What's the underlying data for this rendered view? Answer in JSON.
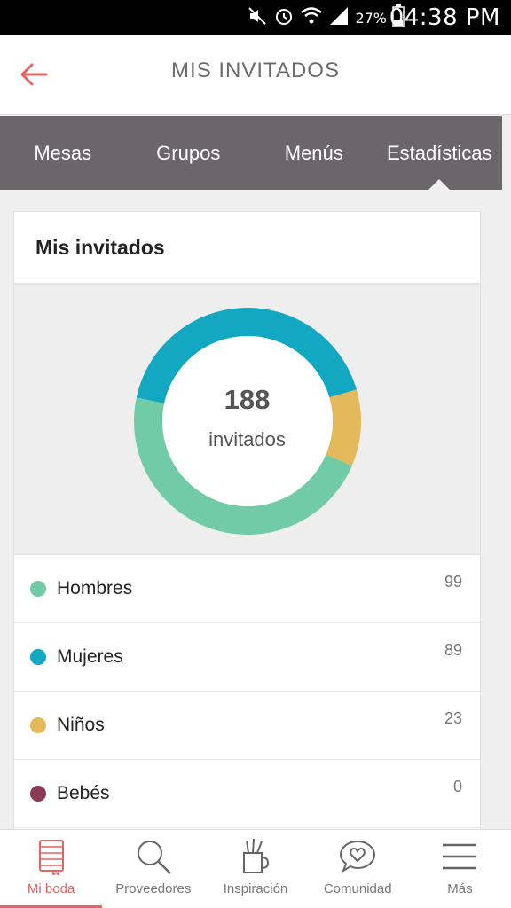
{
  "status_bar": {
    "battery_percent": "27%",
    "time": "04:38 PM"
  },
  "header": {
    "title": "MIS INVITADOS"
  },
  "tabs": [
    {
      "label": "Mesas",
      "active": false
    },
    {
      "label": "Grupos",
      "active": false
    },
    {
      "label": "Menús",
      "active": false
    },
    {
      "label": "Estadísticas",
      "active": true
    }
  ],
  "card": {
    "title": "Mis invitados",
    "total": "188",
    "total_label": "invitados"
  },
  "chart_data": {
    "type": "pie",
    "series": [
      {
        "name": "Hombres",
        "value": 99,
        "color": "#71cba7"
      },
      {
        "name": "Mujeres",
        "value": 89,
        "color": "#13a8c2"
      },
      {
        "name": "Niños",
        "value": 23,
        "color": "#e4b95b"
      },
      {
        "name": "Bebés",
        "value": 0,
        "color": "#8a3a55"
      }
    ]
  },
  "legend": [
    {
      "label": "Hombres",
      "count": "99",
      "color": "#71cba7"
    },
    {
      "label": "Mujeres",
      "count": "89",
      "color": "#13a8c2"
    },
    {
      "label": "Niños",
      "count": "23",
      "color": "#e4b95b"
    },
    {
      "label": "Bebés",
      "count": "0",
      "color": "#8a3a55"
    }
  ],
  "bottom_nav": [
    {
      "label": "Mi boda",
      "icon": "notebook-icon",
      "active": true
    },
    {
      "label": "Proveedores",
      "icon": "search-icon",
      "active": false
    },
    {
      "label": "Inspiración",
      "icon": "pencil-cup-icon",
      "active": false
    },
    {
      "label": "Comunidad",
      "icon": "chat-heart-icon",
      "active": false
    },
    {
      "label": "Más",
      "icon": "menu-icon",
      "active": false
    }
  ],
  "accent_color": "#e06563"
}
